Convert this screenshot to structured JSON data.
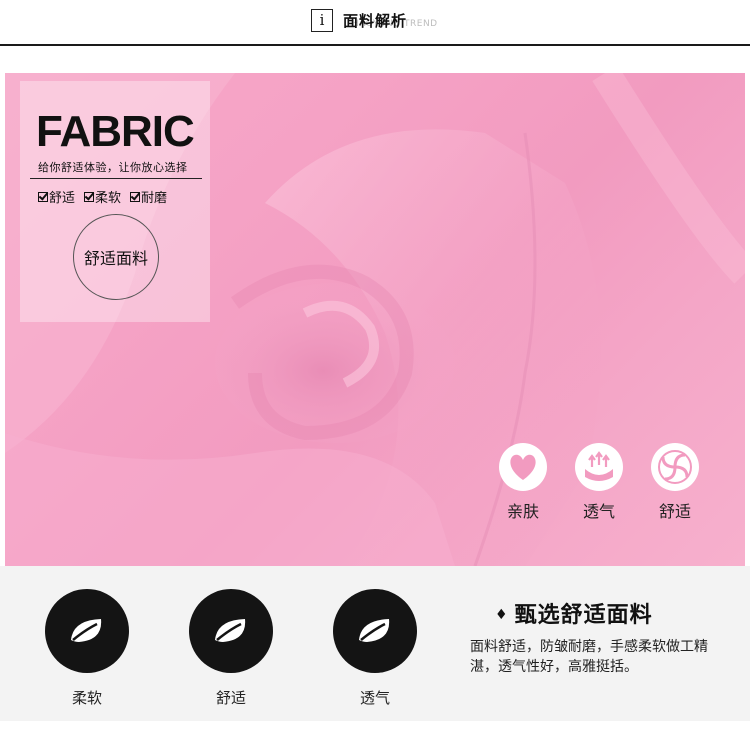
{
  "header": {
    "info_symbol": "i",
    "title": "面料解析",
    "ghost_text": "HAOYONG TREND"
  },
  "hero": {
    "card": {
      "word": "FABRIC",
      "tagline": "给你舒适体验，让你放心选择",
      "checks": [
        "舒适",
        "柔软",
        "耐磨"
      ],
      "badge": "舒适面料"
    },
    "features": [
      {
        "icon": "heart-icon",
        "label": "亲肤"
      },
      {
        "icon": "breathable-icon",
        "label": "透气"
      },
      {
        "icon": "swirl-icon",
        "label": "舒适"
      }
    ]
  },
  "bottom": {
    "items": [
      {
        "icon": "leaf-icon",
        "label": "柔软"
      },
      {
        "icon": "leaf-icon",
        "label": "舒适"
      },
      {
        "icon": "leaf-icon",
        "label": "透气"
      }
    ],
    "headline_marker": "♦",
    "headline": "甄选舒适面料",
    "description": "面料舒适，防皱耐磨，手感柔软做工精湛，透气性好，高雅挺括。"
  },
  "colors": {
    "hero_pink": "#f29bc0",
    "icon_disc": "#141414",
    "bottom_bg": "#f3f3f3"
  }
}
